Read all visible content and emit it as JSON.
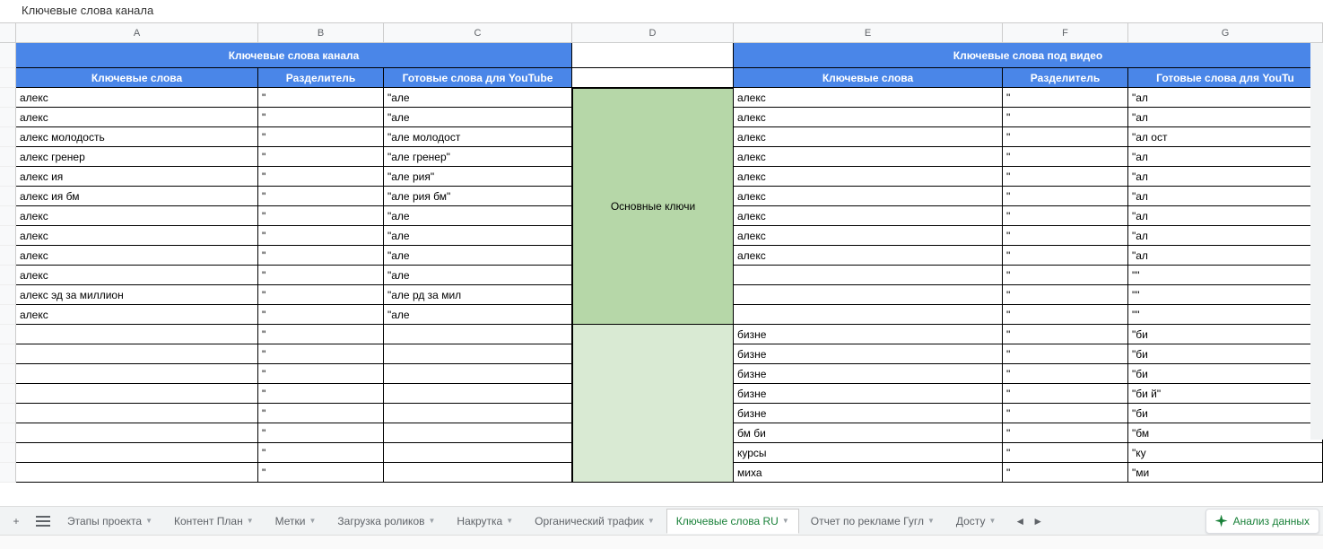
{
  "sheet_title": "Ключевые слова канала",
  "col_letters": [
    "A",
    "B",
    "C",
    "D",
    "E",
    "F",
    "G"
  ],
  "headers": {
    "left_group": "Ключевые слова канала",
    "right_group": "Ключевые слова под видео",
    "keywords": "Ключевые слова",
    "separator": "Разделитель",
    "ready": "Готовые слова для YouTube",
    "ready_cut": "Готовые слова для YouTu"
  },
  "d_label": "Основные ключи",
  "left_rows": [
    {
      "a": "алекс",
      "b": "\"",
      "c": "\"але"
    },
    {
      "a": "алекс",
      "b": "\"",
      "c": "\"але"
    },
    {
      "a": "алекс               молодость",
      "b": "\"",
      "c": "\"але                         молодост"
    },
    {
      "a": "алекс               гренер",
      "b": "\"",
      "c": "\"але                         гренер\""
    },
    {
      "a": "алекс               ия",
      "b": "\"",
      "c": "\"але                         рия\""
    },
    {
      "a": "алекс               ия бм",
      "b": "\"",
      "c": "\"але                         рия бм\""
    },
    {
      "a": "алекс",
      "b": "\"",
      "c": "\"але"
    },
    {
      "a": "алекс",
      "b": "\"",
      "c": "\"але"
    },
    {
      "a": "алекс",
      "b": "\"",
      "c": "\"але"
    },
    {
      "a": "алекс",
      "b": "\"",
      "c": "\"але"
    },
    {
      "a": "алекс               эд за миллион",
      "b": "\"",
      "c": "\"але                         рд за мил"
    },
    {
      "a": "алекс",
      "b": "\"",
      "c": "\"але"
    },
    {
      "a": "",
      "b": "\"",
      "c": ""
    },
    {
      "a": "",
      "b": "\"",
      "c": ""
    },
    {
      "a": "",
      "b": "\"",
      "c": ""
    },
    {
      "a": "",
      "b": "\"",
      "c": ""
    },
    {
      "a": "",
      "b": "\"",
      "c": ""
    },
    {
      "a": "",
      "b": "\"",
      "c": ""
    },
    {
      "a": "",
      "b": "\"",
      "c": ""
    },
    {
      "a": "",
      "b": "\"",
      "c": ""
    }
  ],
  "right_rows": [
    {
      "e": "алекс",
      "f": "\"",
      "g": "\"ал"
    },
    {
      "e": "алекс",
      "f": "\"",
      "g": "\"ал"
    },
    {
      "e": "алекс",
      "f": "\"",
      "g": "\"ал                              ост"
    },
    {
      "e": "алекс",
      "f": "\"",
      "g": "\"ал"
    },
    {
      "e": "алекс",
      "f": "\"",
      "g": "\"ал"
    },
    {
      "e": "алекс",
      "f": "\"",
      "g": "\"ал"
    },
    {
      "e": "алекс",
      "f": "\"",
      "g": "\"ал"
    },
    {
      "e": "алекс",
      "f": "\"",
      "g": "\"ал"
    },
    {
      "e": "алекс",
      "f": "\"",
      "g": "\"ал"
    },
    {
      "e": "",
      "f": "\"",
      "g": "\"\""
    },
    {
      "e": "",
      "f": "\"",
      "g": "\"\""
    },
    {
      "e": "",
      "f": "\"",
      "g": "\"\""
    },
    {
      "e": "бизне",
      "f": "\"",
      "g": "\"би"
    },
    {
      "e": "бизне",
      "f": "\"",
      "g": "\"би"
    },
    {
      "e": "бизне",
      "f": "\"",
      "g": "\"би"
    },
    {
      "e": "бизне",
      "f": "\"",
      "g": "\"би                              й\""
    },
    {
      "e": "бизне",
      "f": "\"",
      "g": "\"би"
    },
    {
      "e": "бм би",
      "f": "\"",
      "g": "\"бм"
    },
    {
      "e": "курсы",
      "f": "\"",
      "g": "\"ку"
    },
    {
      "e": "миха",
      "f": "\"",
      "g": "\"ми"
    }
  ],
  "tabs": [
    {
      "label": "Этапы проекта",
      "active": false
    },
    {
      "label": "Контент План",
      "active": false
    },
    {
      "label": "Метки",
      "active": false
    },
    {
      "label": "Загрузка роликов",
      "active": false
    },
    {
      "label": "Накрутка",
      "active": false
    },
    {
      "label": "Органический трафик",
      "active": false
    },
    {
      "label": "Ключевые слова RU",
      "active": true
    },
    {
      "label": "Отчет по рекламе Гугл",
      "active": false
    },
    {
      "label": "Досту",
      "active": false
    }
  ],
  "explore_label": "Анализ данных",
  "add_label": "+",
  "nav_left": "◄",
  "nav_right": "►"
}
